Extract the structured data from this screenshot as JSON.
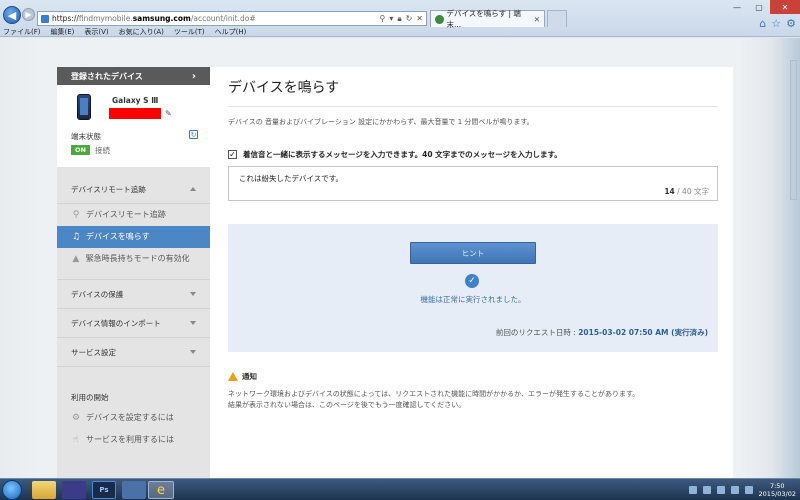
{
  "browser": {
    "url_prefix": "https://",
    "url_host_pre": "findmymobile.",
    "url_host_main": "samsung.com",
    "url_path": "/account/init.do#",
    "tab_title": "デバイスを鳴らす | 端末...",
    "menu": [
      "ファイル(F)",
      "編集(E)",
      "表示(V)",
      "お気に入り(A)",
      "ツール(T)",
      "ヘルプ(H)"
    ]
  },
  "sidebar": {
    "header": "登録されたデバイス",
    "device_name": "Galaxy S Ⅲ",
    "status_label": "端末状態",
    "status_badge": "ON",
    "status_text": "接続",
    "sections": {
      "remote": "デバイスリモート追跡",
      "protect": "デバイスの保護",
      "import": "デバイス情報のインポート",
      "service": "サービス設定",
      "usage": "利用の開始"
    },
    "items": {
      "track": "デバイスリモート追跡",
      "ring": "デバイスを鳴らす",
      "emergency": "緊急時長持ちモードの有効化",
      "setup": "デバイスを設定するには",
      "use": "サービスを利用するには"
    }
  },
  "main": {
    "title": "デバイスを鳴らす",
    "description": "デバイスの 音量およびバイブレーション 設定にかかわらず、最大音量で 1 分間ベルが鳴ります。",
    "checkbox_label": "着信音と一緒に表示するメッセージを入力できます。40 文字までのメッセージを入力します。",
    "message": "これは紛失したデバイスです。",
    "char_count": "14",
    "char_max": " / 40 文字",
    "hint_button": "ヒント",
    "success_text": "機能は正常に実行されました。",
    "last_request_label": "前回のリクエスト日時 : ",
    "last_request_value": "2015-03-02 07:50 AM (実行済み)",
    "notice_title": "通知",
    "notice_line1": "ネットワーク環境およびデバイスの状態によっては、リクエストされた機能に時間がかかるか、エラーが発生することがあります。",
    "notice_line2": "結果が表示されない場合は、このページを後でもう一度確認してください。"
  },
  "taskbar": {
    "ps_label": "Ps",
    "time": "7:50",
    "date": "2015/03/02"
  },
  "colors": {
    "accent": "#4b86c5",
    "on_badge": "#4aaa3a",
    "redaction": "#ff0000"
  }
}
